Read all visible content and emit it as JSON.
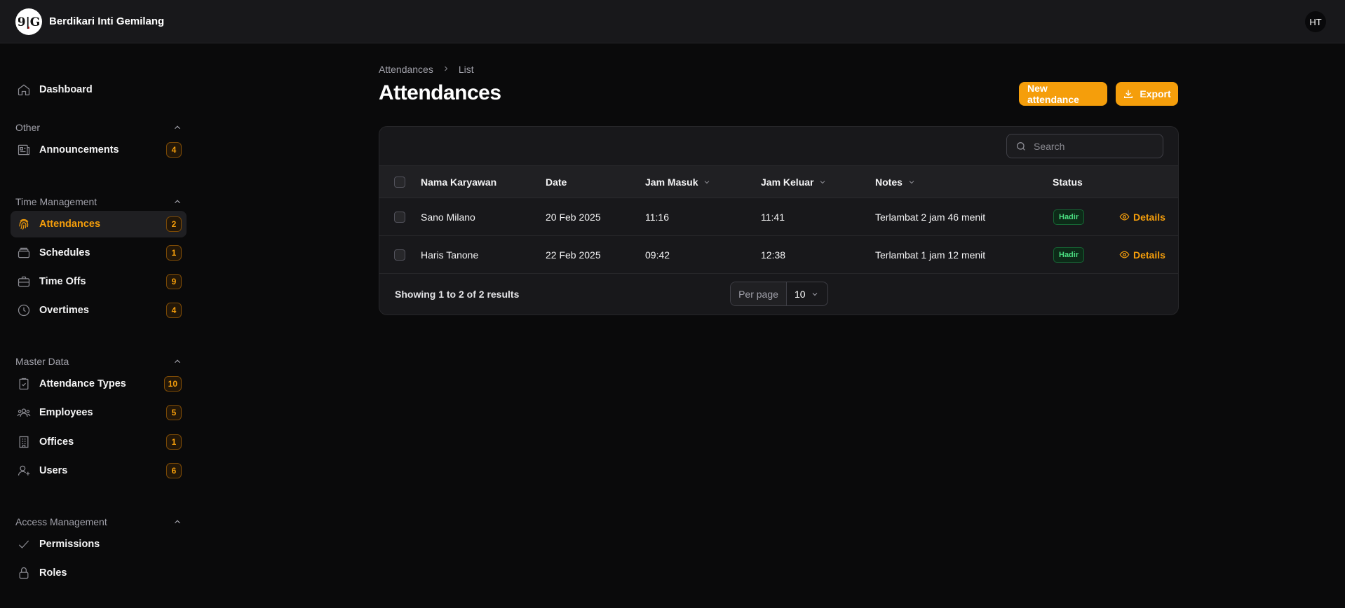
{
  "app": {
    "brand": "Berdikari Inti Gemilang",
    "user_initials": "HT"
  },
  "sidebar": {
    "dashboard": {
      "label": "Dashboard",
      "icon": "home-icon"
    },
    "groups": [
      {
        "title": "Other",
        "items": [
          {
            "label": "Announcements",
            "badge": "4",
            "icon": "newspaper-icon"
          }
        ]
      },
      {
        "title": "Time Management",
        "items": [
          {
            "label": "Attendances",
            "badge": "2",
            "icon": "fingerprint-icon",
            "active": true
          },
          {
            "label": "Schedules",
            "badge": "1",
            "icon": "stack-icon"
          },
          {
            "label": "Time Offs",
            "badge": "9",
            "icon": "briefcase-icon"
          },
          {
            "label": "Overtimes",
            "badge": "4",
            "icon": "clock-icon"
          }
        ]
      },
      {
        "title": "Master Data",
        "items": [
          {
            "label": "Attendance Types",
            "badge": "10",
            "icon": "clipboard-check-icon"
          },
          {
            "label": "Employees",
            "badge": "5",
            "icon": "users-group-icon"
          },
          {
            "label": "Offices",
            "badge": "1",
            "icon": "building-icon"
          },
          {
            "label": "Users",
            "badge": "6",
            "icon": "user-plus-icon"
          }
        ]
      },
      {
        "title": "Access Management",
        "items": [
          {
            "label": "Permissions",
            "icon": "check-icon"
          },
          {
            "label": "Roles",
            "icon": "lock-icon"
          }
        ]
      }
    ]
  },
  "page": {
    "breadcrumb": [
      "Attendances",
      "List"
    ],
    "title": "Attendances",
    "new_button": "New attendance",
    "export_button": "Export",
    "search_placeholder": "Search"
  },
  "table": {
    "columns": {
      "name": "Nama Karyawan",
      "date": "Date",
      "jam_masuk": "Jam Masuk",
      "jam_keluar": "Jam Keluar",
      "notes": "Notes",
      "status": "Status"
    },
    "rows": [
      {
        "name": "Sano Milano",
        "date": "20 Feb 2025",
        "jam_masuk": "11:16",
        "jam_keluar": "11:41",
        "notes": "Terlambat 2 jam 46 menit",
        "status": "Hadir",
        "action": "Details"
      },
      {
        "name": "Haris Tanone",
        "date": "22 Feb 2025",
        "jam_masuk": "09:42",
        "jam_keluar": "12:38",
        "notes": "Terlambat 1 jam 12 menit",
        "status": "Hadir",
        "action": "Details"
      }
    ],
    "showing": "Showing 1 to 2 of 2 results",
    "per_page_label": "Per page",
    "per_page_value": "10"
  },
  "colors": {
    "accent": "#f59e0b",
    "status_success": "#4ade80",
    "background": "#0a0a0b"
  }
}
